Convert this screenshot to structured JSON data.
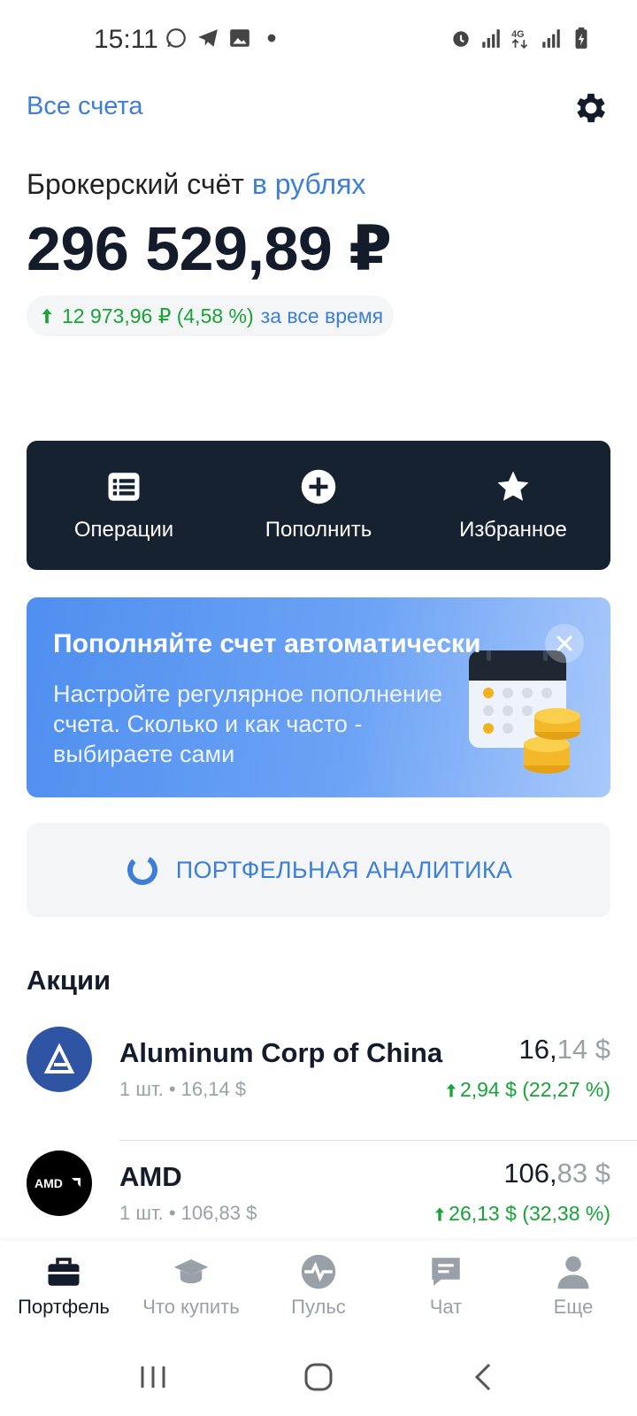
{
  "status_bar": {
    "time": "15:11"
  },
  "header": {
    "all_accounts": "Все счета"
  },
  "account": {
    "title": "Брокерский счёт",
    "currency_label": "в рублях",
    "balance": "296 529,89 ₽",
    "pl_value": "12 973,96 ₽ (4,58 %)",
    "pl_period": "за все время"
  },
  "actions": [
    {
      "label": "Операции",
      "icon": "list-icon"
    },
    {
      "label": "Пополнить",
      "icon": "plus-circle-icon"
    },
    {
      "label": "Избранное",
      "icon": "star-icon"
    }
  ],
  "promo": {
    "title": "Пополняйте счет автоматически",
    "text": "Настройте регулярное пополнение счета. Сколько и как часто - выбираете сами"
  },
  "analytics": {
    "label": "ПОРТФЕЛЬНАЯ АНАЛИТИКА"
  },
  "stocks": {
    "section_title": "Акции",
    "items": [
      {
        "name": "Aluminum Corp of China",
        "sub": "1 шт. • 16,14 $",
        "price_int": "16,",
        "price_dec": "14 $",
        "change": "2,94 $ (22,27 %)",
        "logo_color": "#2f54a4"
      },
      {
        "name": "AMD",
        "sub": "1 шт. • 106,83 $",
        "price_int": "106,",
        "price_dec": "83 $",
        "change": "26,13 $ (32,38 %)",
        "logo_color": "#000000"
      }
    ]
  },
  "bottom_nav": [
    {
      "label": "Портфель",
      "icon": "briefcase-icon",
      "active": true
    },
    {
      "label": "Что купить",
      "icon": "graduation-cap-icon",
      "active": false
    },
    {
      "label": "Пульс",
      "icon": "pulse-icon",
      "active": false
    },
    {
      "label": "Чат",
      "icon": "chat-icon",
      "active": false
    },
    {
      "label": "Еще",
      "icon": "user-icon",
      "active": false
    }
  ],
  "colors": {
    "accent": "#3d7fd6",
    "positive": "#17a336",
    "dark_panel": "#172230",
    "muted": "#9aa0a8"
  }
}
